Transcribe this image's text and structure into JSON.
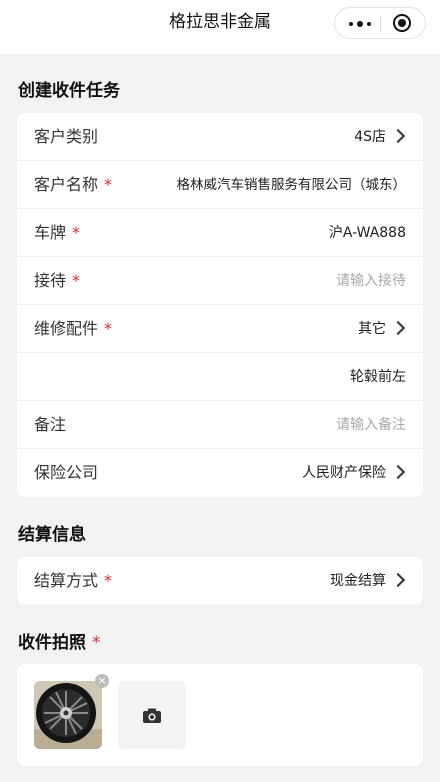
{
  "nav": {
    "title": "格拉思非金属"
  },
  "sections": {
    "task_title": "创建收件任务",
    "settle_title": "结算信息",
    "photo_title": "收件拍照"
  },
  "required_mark": "*",
  "form": {
    "customer_type": {
      "label": "客户类别",
      "value": "4S店"
    },
    "customer_name": {
      "label": "客户名称",
      "value": "格林威汽车销售服务有限公司（城东）"
    },
    "plate": {
      "label": "车牌",
      "value": "沪A-WA888"
    },
    "reception": {
      "label": "接待",
      "placeholder": "请输入接待"
    },
    "parts": {
      "label": "维修配件",
      "value": "其它"
    },
    "parts_detail": {
      "value": "轮毂前左"
    },
    "remark": {
      "label": "备注",
      "placeholder": "请输入备注"
    },
    "insurance": {
      "label": "保险公司",
      "value": "人民财产保险"
    }
  },
  "settlement": {
    "method": {
      "label": "结算方式",
      "value": "现金结算"
    }
  },
  "photos": {
    "remove_icon": "×"
  },
  "icons": {
    "more": "more-dots-icon",
    "close": "target-icon",
    "arrow": "chevron-right-icon",
    "camera": "camera-icon"
  },
  "colors": {
    "required": "#e03030",
    "placeholder": "#a8a8a8",
    "background": "#f2f2f2"
  }
}
